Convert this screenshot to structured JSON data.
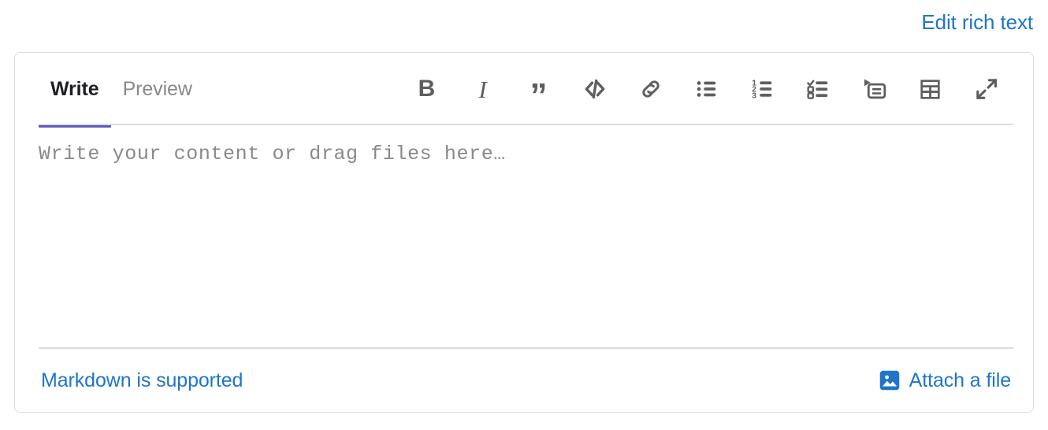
{
  "header": {
    "rich_text_link": "Edit rich text"
  },
  "editor": {
    "tabs": [
      {
        "label": "Write",
        "active": true,
        "name": "tab-write"
      },
      {
        "label": "Preview",
        "active": false,
        "name": "tab-preview"
      }
    ],
    "toolbar": [
      {
        "name": "bold-icon",
        "label": "Bold",
        "glyph": "B"
      },
      {
        "name": "italic-icon",
        "label": "Italic",
        "glyph": "I"
      },
      {
        "name": "quote-icon",
        "label": "Insert a quote",
        "glyph": "”"
      },
      {
        "name": "code-icon",
        "label": "Insert code"
      },
      {
        "name": "link-icon",
        "label": "Add a link"
      },
      {
        "name": "bulleted-list-icon",
        "label": "Add a bullet list"
      },
      {
        "name": "numbered-list-icon",
        "label": "Add a numbered list"
      },
      {
        "name": "checklist-icon",
        "label": "Add a checklist"
      },
      {
        "name": "collapsible-section-icon",
        "label": "Add a collapsible section"
      },
      {
        "name": "table-icon",
        "label": "Add a table"
      },
      {
        "name": "fullscreen-icon",
        "label": "Go full screen"
      }
    ],
    "textarea": {
      "value": "",
      "placeholder": "Write your content or drag files here…"
    },
    "footer": {
      "markdown_link": "Markdown is supported",
      "attach_label": "Attach a file",
      "attach_icon": "image-icon"
    }
  },
  "colors": {
    "link": "#1f75cb",
    "active_tab_underline": "#6159c0",
    "border": "#dcdcde",
    "icon": "#5e5e61",
    "placeholder": "#89888d",
    "background": "#ffffff"
  }
}
